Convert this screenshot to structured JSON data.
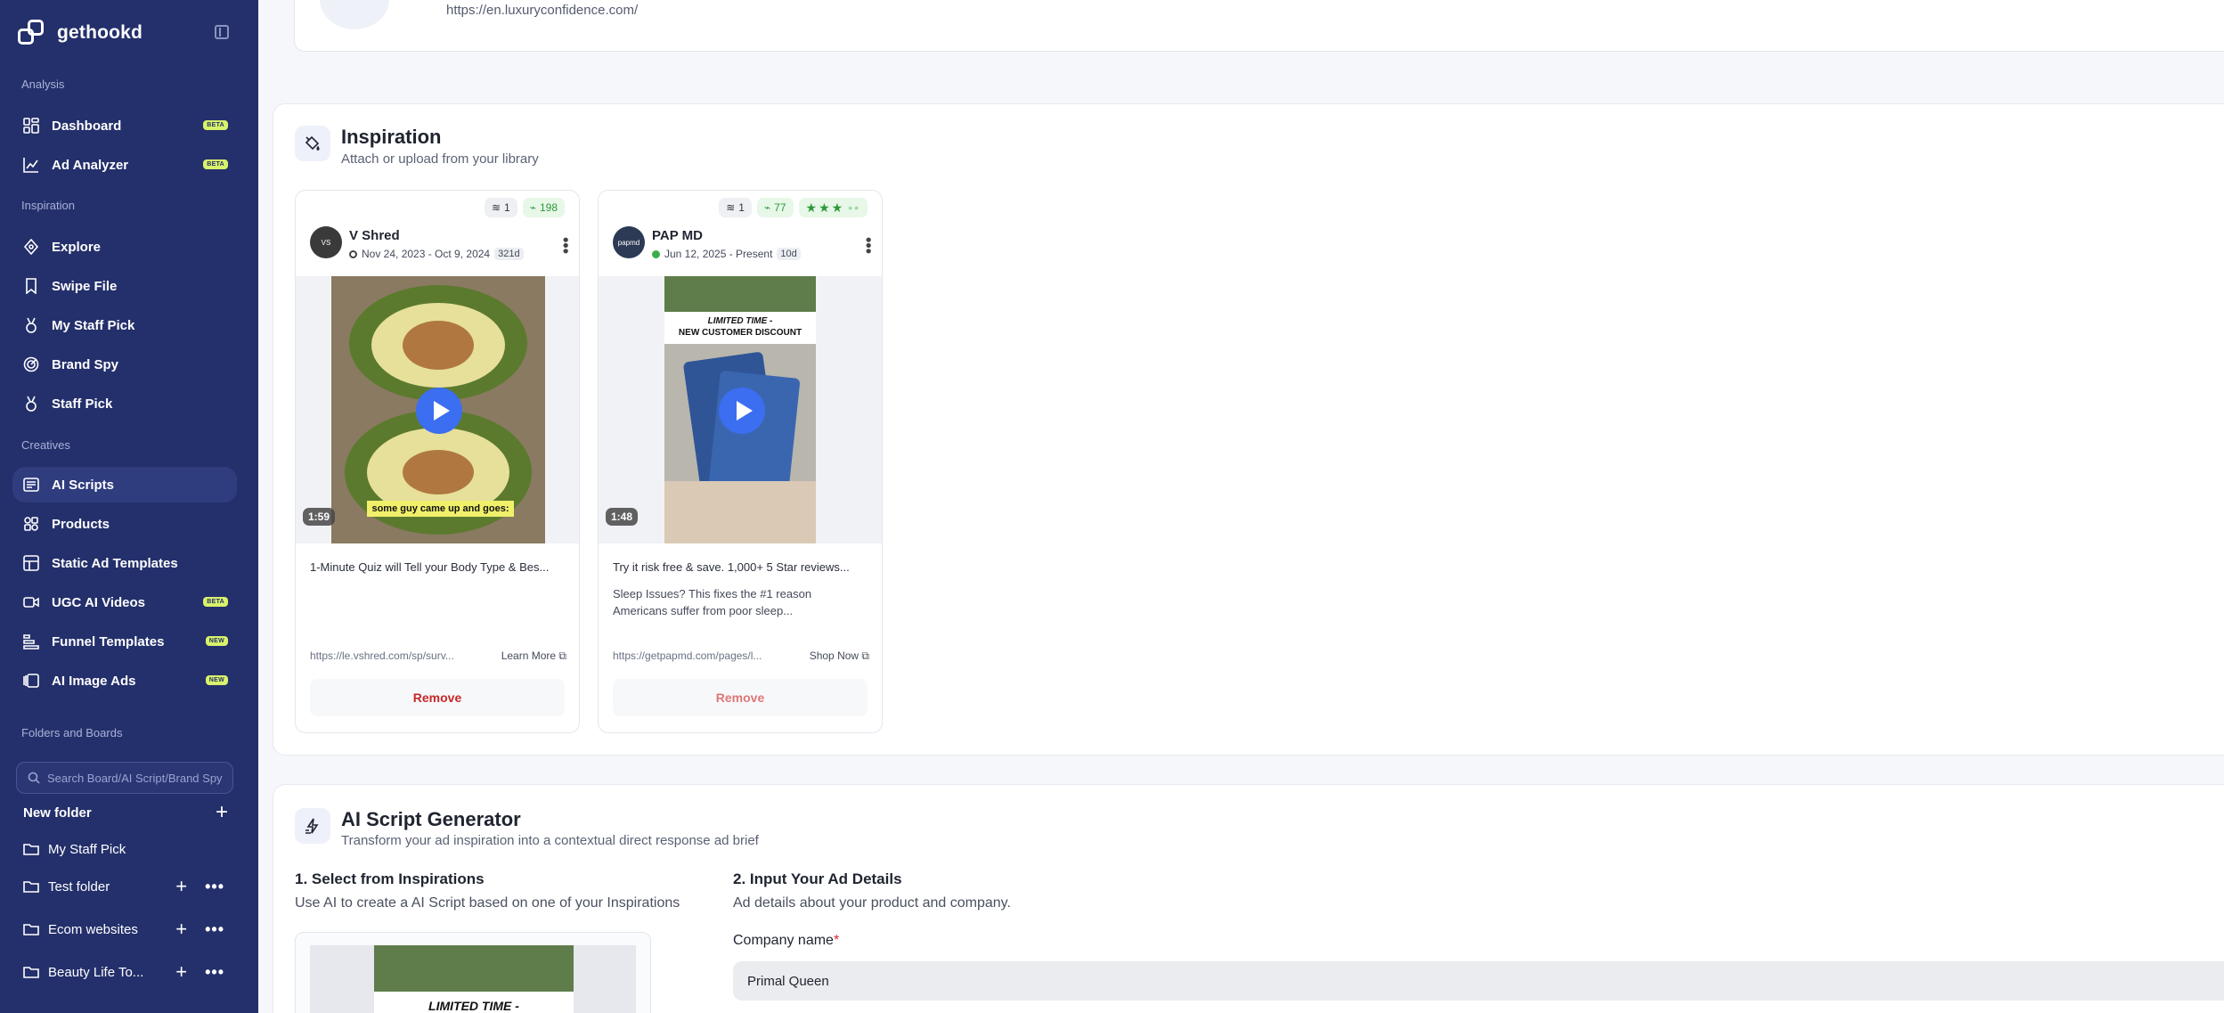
{
  "app": {
    "name": "gethookd"
  },
  "sidebar": {
    "sections": {
      "analysis": "Analysis",
      "inspiration": "Inspiration",
      "creatives": "Creatives",
      "folders": "Folders and Boards"
    },
    "analysis_items": [
      {
        "label": "Dashboard",
        "badge": "BETA",
        "icon": "dashboard-icon"
      },
      {
        "label": "Ad Analyzer",
        "badge": "BETA",
        "icon": "chart-icon"
      }
    ],
    "inspiration_items": [
      {
        "label": "Explore",
        "icon": "compass-icon"
      },
      {
        "label": "Swipe File",
        "icon": "bookmark-icon"
      },
      {
        "label": "My Staff Pick",
        "icon": "medal-icon"
      },
      {
        "label": "Brand Spy",
        "icon": "radar-icon"
      },
      {
        "label": "Staff Pick",
        "icon": "medal-icon"
      }
    ],
    "creatives_items": [
      {
        "label": "AI Scripts",
        "icon": "script-icon",
        "active": true
      },
      {
        "label": "Products",
        "icon": "products-icon"
      },
      {
        "label": "Static Ad Templates",
        "icon": "template-icon"
      },
      {
        "label": "UGC AI Videos",
        "badge": "BETA",
        "icon": "video-icon"
      },
      {
        "label": "Funnel Templates",
        "badge": "NEW",
        "icon": "funnel-icon"
      },
      {
        "label": "AI Image Ads",
        "badge": "NEW",
        "icon": "images-icon"
      }
    ],
    "search_placeholder": "Search Board/AI Script/Brand Spy",
    "new_folder": "New folder",
    "folders": [
      "My Staff Pick",
      "Test folder",
      "Ecom websites",
      "Beauty Life To..."
    ]
  },
  "top_card": {
    "url": "https://en.luxuryconfidence.com/"
  },
  "inspiration": {
    "title": "Inspiration",
    "subtitle": "Attach or upload from your library",
    "ads": [
      {
        "brand": "V Shred",
        "dates": "Nov 24, 2023 - Oct 9, 2024",
        "days": "321d",
        "variants": "1",
        "score": "198",
        "duration": "1:59",
        "caption": "some guy came up and goes:",
        "headline": "1-Minute Quiz will Tell your Body Type & Bes...",
        "description": "",
        "link": "https://le.vshred.com/sp/surv...",
        "cta": "Learn More",
        "remove": "Remove"
      },
      {
        "brand": "PAP MD",
        "avatar_text": "papmd",
        "dates": "Jun 12, 2025 - Present",
        "days": "10d",
        "variants": "1",
        "score": "77",
        "duration": "1:48",
        "banner_line1": "LIMITED TIME -",
        "banner_line2": "NEW CUSTOMER DISCOUNT",
        "headline": "Try it risk free & save. 1,000+ 5 Star reviews...",
        "description": "Sleep Issues? This fixes the #1 reason Americans suffer from poor sleep...",
        "link": "https://getpapmd.com/pages/l...",
        "cta": "Shop Now",
        "remove": "Remove",
        "rating_stars": 3,
        "rating_max": 5
      }
    ]
  },
  "generator": {
    "title": "AI Script Generator",
    "subtitle": "Transform your ad inspiration into a contextual direct response ad brief",
    "step1_title": "1. Select from Inspirations",
    "step1_sub": "Use AI to create a AI Script based on one of your Inspirations",
    "step2_title": "2. Input Your Ad Details",
    "step2_sub": "Ad details about your product and company.",
    "company_label": "Company name",
    "company_required": "*",
    "company_value": "Primal Queen",
    "selected_banner": "LIMITED TIME -"
  },
  "colors": {
    "sidebar_bg": "#24306b",
    "accent": "#3b6ef0",
    "badge": "#d8f26a",
    "danger": "#c62828"
  }
}
